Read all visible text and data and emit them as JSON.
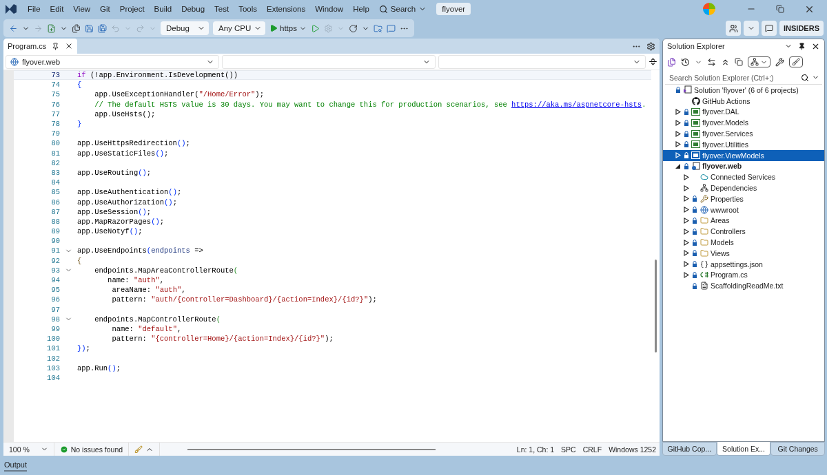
{
  "menu": [
    "File",
    "Edit",
    "View",
    "Git",
    "Project",
    "Build",
    "Debug",
    "Test",
    "Tools",
    "Extensions",
    "Window",
    "Help"
  ],
  "search": {
    "label": "Search"
  },
  "solution_badge": "flyover",
  "toolbar": {
    "configuration": "Debug",
    "platform": "Any CPU",
    "run_target": "https",
    "account_label": "INSIDERS"
  },
  "editor": {
    "tab": {
      "title": "Program.cs"
    },
    "nav": {
      "project": "flyover.web"
    },
    "lines": [
      {
        "number": "73",
        "current": true,
        "tokens": [
          {
            "kind": "keyword",
            "text": "if"
          },
          {
            "kind": "plain",
            "text": " (!app.Environment.IsDevelopment())"
          }
        ]
      },
      {
        "number": "74",
        "current": false,
        "tokens": [
          {
            "kind": "punctuation",
            "text": "{"
          }
        ]
      },
      {
        "number": "75",
        "current": false,
        "tokens": [
          {
            "kind": "plain",
            "text": "    app.UseExceptionHandler("
          },
          {
            "kind": "string",
            "text": "\"/Home/Error\""
          },
          {
            "kind": "plain",
            "text": ");"
          }
        ]
      },
      {
        "number": "76",
        "current": false,
        "tokens": [
          {
            "kind": "comment",
            "text": "    // The default HSTS value is 30 days. You may want to change this for production scenarios, see "
          },
          {
            "kind": "link",
            "text": "https://aka.ms/aspnetcore-hsts"
          },
          {
            "kind": "comment",
            "text": "."
          }
        ]
      },
      {
        "number": "77",
        "current": false,
        "tokens": [
          {
            "kind": "plain",
            "text": "    app.UseHsts();"
          }
        ]
      },
      {
        "number": "78",
        "current": false,
        "tokens": [
          {
            "kind": "punctuation",
            "text": "}"
          }
        ]
      },
      {
        "number": "79",
        "current": false
      },
      {
        "number": "80",
        "current": false,
        "tokens": [
          {
            "kind": "plain",
            "text": "app.UseHttpsRedirection"
          },
          {
            "kind": "punctuation",
            "text": "()"
          },
          {
            "kind": "plain",
            "text": ";"
          }
        ]
      },
      {
        "number": "81",
        "current": false,
        "tokens": [
          {
            "kind": "plain",
            "text": "app.UseStaticFiles"
          },
          {
            "kind": "punctuation",
            "text": "()"
          },
          {
            "kind": "plain",
            "text": ";"
          }
        ]
      },
      {
        "number": "82",
        "current": false
      },
      {
        "number": "83",
        "current": false,
        "tokens": [
          {
            "kind": "plain",
            "text": "app.UseRouting"
          },
          {
            "kind": "punctuation",
            "text": "()"
          },
          {
            "kind": "plain",
            "text": ";"
          }
        ]
      },
      {
        "number": "84",
        "current": false
      },
      {
        "number": "85",
        "current": false,
        "tokens": [
          {
            "kind": "plain",
            "text": "app.UseAuthentication"
          },
          {
            "kind": "punctuation",
            "text": "()"
          },
          {
            "kind": "plain",
            "text": ";"
          }
        ]
      },
      {
        "number": "86",
        "current": false,
        "tokens": [
          {
            "kind": "plain",
            "text": "app.UseAuthorization"
          },
          {
            "kind": "punctuation",
            "text": "()"
          },
          {
            "kind": "plain",
            "text": ";"
          }
        ]
      },
      {
        "number": "87",
        "current": false,
        "tokens": [
          {
            "kind": "plain",
            "text": "app.UseSession"
          },
          {
            "kind": "punctuation",
            "text": "()"
          },
          {
            "kind": "plain",
            "text": ";"
          }
        ]
      },
      {
        "number": "88",
        "current": false,
        "tokens": [
          {
            "kind": "plain",
            "text": "app.MapRazorPages"
          },
          {
            "kind": "punctuation",
            "text": "()"
          },
          {
            "kind": "plain",
            "text": ";"
          }
        ]
      },
      {
        "number": "89",
        "current": false,
        "tokens": [
          {
            "kind": "plain",
            "text": "app.UseNotyf"
          },
          {
            "kind": "punctuation",
            "text": "()"
          },
          {
            "kind": "plain",
            "text": ";"
          }
        ]
      },
      {
        "number": "90",
        "current": false
      },
      {
        "number": "91",
        "current": false,
        "collapsible": true,
        "tokens": [
          {
            "kind": "plain",
            "text": "app.UseEndpoints"
          },
          {
            "kind": "punctuation",
            "text": "("
          },
          {
            "kind": "parameter",
            "text": "endpoints"
          },
          {
            "kind": "plain",
            "text": " =>"
          }
        ]
      },
      {
        "number": "92",
        "current": false,
        "tokens": [
          {
            "kind": "brace",
            "text": "{"
          }
        ]
      },
      {
        "number": "93",
        "current": false,
        "collapsible": true,
        "tokens": [
          {
            "kind": "plain",
            "text": "    endpoints.MapAreaControllerRoute"
          },
          {
            "kind": "bracket",
            "text": "("
          }
        ]
      },
      {
        "number": "94",
        "current": false,
        "tokens": [
          {
            "kind": "plain",
            "text": "       name: "
          },
          {
            "kind": "string",
            "text": "\"auth\""
          },
          {
            "kind": "plain",
            "text": ","
          }
        ]
      },
      {
        "number": "95",
        "current": false,
        "tokens": [
          {
            "kind": "plain",
            "text": "        areaName: "
          },
          {
            "kind": "string",
            "text": "\"auth\""
          },
          {
            "kind": "plain",
            "text": ","
          }
        ]
      },
      {
        "number": "96",
        "current": false,
        "tokens": [
          {
            "kind": "plain",
            "text": "        pattern: "
          },
          {
            "kind": "string",
            "text": "\"auth/{controller=Dashboard}/{action=Index}/{id?}\""
          },
          {
            "kind": "plain",
            "text": ");"
          }
        ]
      },
      {
        "number": "97",
        "current": false
      },
      {
        "number": "98",
        "current": false,
        "collapsible": true,
        "tokens": [
          {
            "kind": "plain",
            "text": "    endpoints.MapControllerRoute"
          },
          {
            "kind": "bracket",
            "text": "("
          }
        ]
      },
      {
        "number": "99",
        "current": false,
        "tokens": [
          {
            "kind": "plain",
            "text": "        name: "
          },
          {
            "kind": "string",
            "text": "\"default\""
          },
          {
            "kind": "plain",
            "text": ","
          }
        ]
      },
      {
        "number": "100",
        "current": false,
        "tokens": [
          {
            "kind": "plain",
            "text": "        pattern: "
          },
          {
            "kind": "string",
            "text": "\"{controller=Home}/{action=Index}/{id?}\""
          },
          {
            "kind": "plain",
            "text": ");"
          }
        ]
      },
      {
        "number": "101",
        "current": false,
        "tokens": [
          {
            "kind": "punctuation",
            "text": "})"
          },
          {
            "kind": "plain",
            "text": ";"
          }
        ]
      },
      {
        "number": "102",
        "current": false
      },
      {
        "number": "103",
        "current": false,
        "tokens": [
          {
            "kind": "plain",
            "text": "app.Run"
          },
          {
            "kind": "punctuation",
            "text": "()"
          },
          {
            "kind": "plain",
            "text": ";"
          }
        ]
      },
      {
        "number": "104",
        "current": false
      }
    ]
  },
  "status_bar": {
    "zoom": "100 %",
    "issues": "No issues found",
    "position": "Ln: 1, Ch: 1",
    "indent": "SPC",
    "line_endings": "CRLF",
    "encoding": "Windows 1252"
  },
  "solution_explorer": {
    "title": "Solution Explorer",
    "search": {
      "placeholder": "Search Solution Explorer (Ctrl+;)"
    },
    "tree": [
      {
        "label": "Solution 'flyover' (6 of 6 projects)",
        "kind": "solution",
        "locked": true,
        "bold": false,
        "selected": false,
        "children": [
          {
            "label": "GitHub Actions",
            "kind": "github",
            "locked": false,
            "bold": false,
            "selected": false
          },
          {
            "label": "flyover.DAL",
            "kind": "csproj",
            "locked": true,
            "bold": false,
            "expanded": false,
            "selected": false
          },
          {
            "label": "flyover.Models",
            "kind": "csproj",
            "locked": true,
            "bold": false,
            "expanded": false,
            "selected": false
          },
          {
            "label": "flyover.Services",
            "kind": "csproj",
            "locked": true,
            "bold": false,
            "expanded": false,
            "selected": false
          },
          {
            "label": "flyover.Utilities",
            "kind": "csproj",
            "locked": true,
            "bold": false,
            "expanded": false,
            "selected": false
          },
          {
            "label": "flyover.ViewModels",
            "kind": "csproj",
            "locked": true,
            "bold": false,
            "expanded": false,
            "selected": true
          },
          {
            "label": "flyover.web",
            "kind": "webproj",
            "locked": true,
            "bold": true,
            "expanded": true,
            "selected": false,
            "children": [
              {
                "label": "Connected Services",
                "kind": "connected",
                "locked": false,
                "bold": false,
                "expanded": false,
                "selected": false
              },
              {
                "label": "Dependencies",
                "kind": "dependencies",
                "locked": false,
                "bold": false,
                "expanded": false,
                "selected": false
              },
              {
                "label": "Properties",
                "kind": "properties",
                "locked": true,
                "bold": false,
                "expanded": false,
                "selected": false
              },
              {
                "label": "wwwroot",
                "kind": "globe",
                "locked": true,
                "bold": false,
                "expanded": false,
                "selected": false
              },
              {
                "label": "Areas",
                "kind": "folder",
                "locked": true,
                "bold": false,
                "expanded": false,
                "selected": false
              },
              {
                "label": "Controllers",
                "kind": "folder",
                "locked": true,
                "bold": false,
                "expanded": false,
                "selected": false
              },
              {
                "label": "Models",
                "kind": "folder",
                "locked": true,
                "bold": false,
                "expanded": false,
                "selected": false
              },
              {
                "label": "Views",
                "kind": "folder",
                "locked": true,
                "bold": false,
                "expanded": false,
                "selected": false
              },
              {
                "label": "appsettings.json",
                "kind": "json",
                "locked": true,
                "bold": false,
                "expanded": false,
                "selected": false
              },
              {
                "label": "Program.cs",
                "kind": "csharp",
                "locked": true,
                "bold": false,
                "expanded": false,
                "selected": false
              },
              {
                "label": "ScaffoldingReadMe.txt",
                "kind": "text",
                "locked": true,
                "bold": false,
                "selected": false
              }
            ]
          }
        ]
      }
    ]
  },
  "tool_tabs": [
    {
      "label": "GitHub Cop...",
      "selected": false
    },
    {
      "label": "Solution Ex...",
      "selected": true
    },
    {
      "label": "Git Changes",
      "selected": false
    }
  ],
  "bottom_panel": {
    "tab": "Output"
  }
}
